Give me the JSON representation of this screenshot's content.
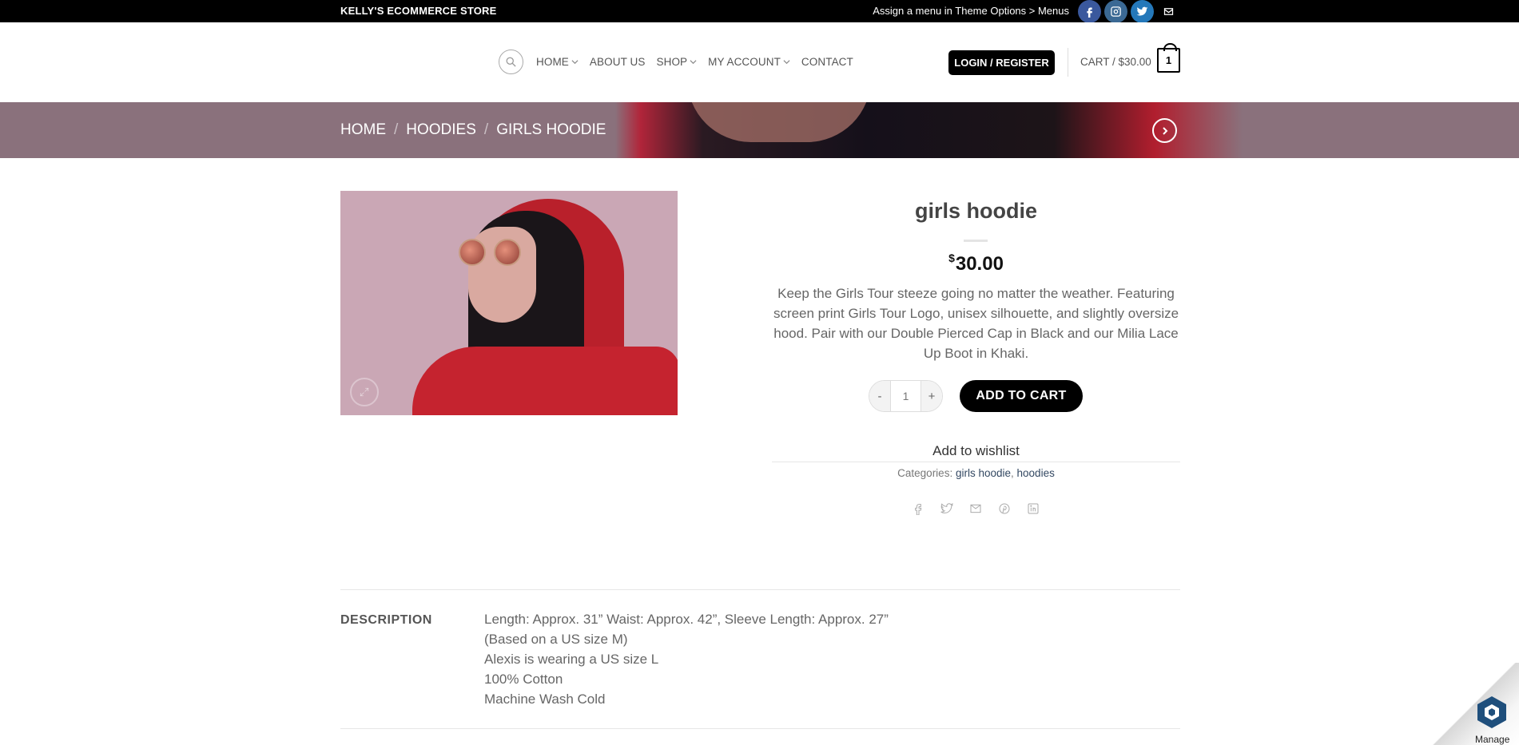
{
  "topbar": {
    "store_name": "KELLY'S ECOMMERCE STORE",
    "menu_note": "Assign a menu in Theme Options > Menus",
    "social_icons": [
      "facebook-icon",
      "instagram-icon",
      "twitter-icon",
      "envelope-icon"
    ]
  },
  "header": {
    "nav": [
      {
        "label": "HOME",
        "has_dropdown": true
      },
      {
        "label": "ABOUT US",
        "has_dropdown": false
      },
      {
        "label": "SHOP",
        "has_dropdown": true
      },
      {
        "label": "MY ACCOUNT",
        "has_dropdown": true
      },
      {
        "label": "CONTACT",
        "has_dropdown": false
      }
    ],
    "login_label": "LOGIN / REGISTER",
    "cart_label": "CART / $30.00",
    "cart_count": "1"
  },
  "breadcrumb": {
    "items": [
      "HOME",
      "HOODIES",
      "GIRLS HOODIE"
    ],
    "separator": "/"
  },
  "product": {
    "title": "girls hoodie",
    "currency": "$",
    "price": "30.00",
    "description": "Keep the Girls Tour steeze going no matter the weather. Featuring screen print Girls Tour Logo, unisex silhouette, and slightly oversize hood. Pair with our Double Pierced Cap in Black and our Milia Lace Up Boot in Khaki.",
    "qty_minus": "-",
    "quantity": "1",
    "qty_plus": "+",
    "add_to_cart": "ADD TO CART",
    "wishlist": "Add to wishlist",
    "categories_label": "Categories:",
    "categories": [
      "girls hoodie",
      "hoodies"
    ],
    "share_icons": [
      "facebook-icon",
      "twitter-icon",
      "envelope-icon",
      "pinterest-icon",
      "linkedin-icon"
    ]
  },
  "tabs": {
    "description_heading": "DESCRIPTION",
    "description_lines": [
      "Length: Approx. 31” Waist: Approx. 42”, Sleeve Length: Approx. 27”",
      "(Based on a US size M)",
      "Alexis is wearing a US size L",
      "100% Cotton",
      "Machine Wash Cold"
    ]
  },
  "manage_badge": {
    "label": "Manage"
  },
  "colors": {
    "topbar": "#000000",
    "banner": "#8a717c",
    "accent": "#000000",
    "link": "#334862"
  }
}
